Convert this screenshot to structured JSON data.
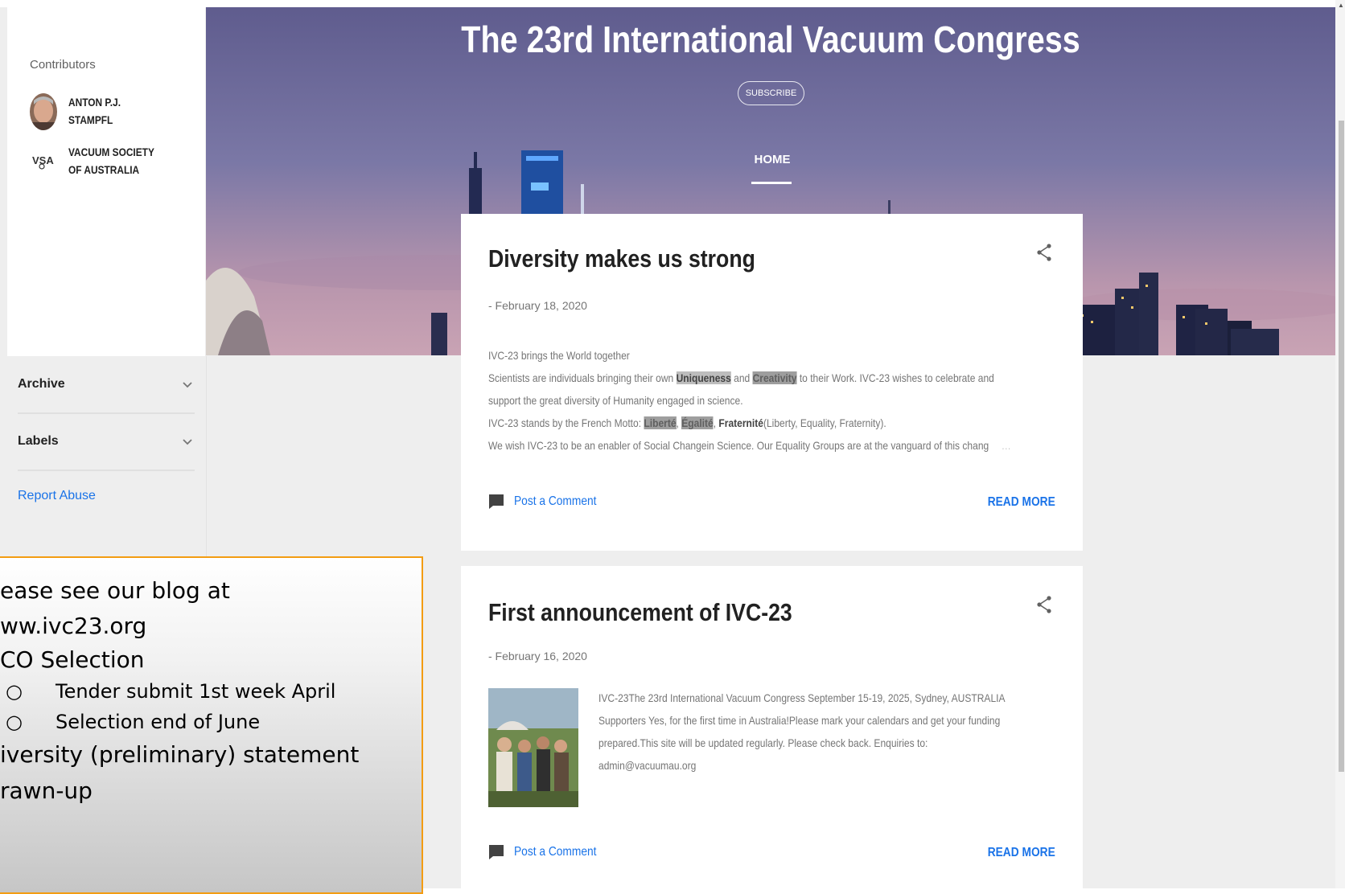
{
  "blog": {
    "title": "The 23rd International Vacuum Congress",
    "subscribe_label": "SUBSCRIBE",
    "nav_home": "HOME"
  },
  "sidebar": {
    "contributors_title": "Contributors",
    "contributors": [
      {
        "name": "ANTON P.J. STAMPFL"
      },
      {
        "name": "VACUUM SOCIETY OF AUSTRALIA",
        "logo_text": "VSA"
      }
    ],
    "archive_label": "Archive",
    "labels_label": "Labels",
    "report_abuse": "Report Abuse"
  },
  "posts": [
    {
      "title": "Diversity makes us strong",
      "date": "- February 18, 2020",
      "line1": "IVC-23 brings the World together",
      "line2_a": "Scientists are individuals bringing their own ",
      "line2_hl1": "Uniqueness",
      "line2_b": " and ",
      "line2_hl2": "Creativity",
      "line2_c": " to their Work. IVC-23 wishes to celebrate and",
      "line3": "support the great diversity of Humanity engaged in science.",
      "line4_a": "IVC-23 stands by the French Motto: ",
      "line4_hl1": "Liberté",
      "line4_b": ", ",
      "line4_hl2": "Égalité",
      "line4_c": ", ",
      "line4_bold": "Fraternité",
      "line4_d": "(Liberty, Equality, Fraternity).",
      "line5": "We wish IVC-23 to be an  enabler of Social Changein Science.  Our Equality Groups are at the vanguard of this chang",
      "ellipsis": "…",
      "comment_label": "Post a Comment",
      "read_more": "READ MORE"
    },
    {
      "title": "First announcement of IVC-23",
      "date": "- February 16, 2020",
      "body_l1": "IVC-23The 23rd International Vacuum Congress September 15-19, 2025, Sydney, AUSTRALIA",
      "body_l2": "Supporters Yes, for the first time in Australia!Please mark your calendars and get your funding",
      "body_l3": "prepared.This site will be updated regularly. Please check back. Enquiries to:",
      "body_l4": "admin@vacuumau.org",
      "comment_label": "Post a Comment",
      "read_more": "READ MORE"
    }
  ],
  "note": {
    "line1": "ease see our blog at",
    "line2": "ww.ivc23.org",
    "line3": "CO Selection",
    "bullets": [
      "Tender submit 1st week April",
      "Selection end of June"
    ],
    "bullet_glyph": "○",
    "line4": "iversity (preliminary) statement",
    "line5": "rawn-up"
  },
  "colors": {
    "accent": "#1a73e8",
    "note_border": "#f39c12",
    "banner_sky_top": "#6d6a9c",
    "banner_sky_bottom": "#c9a3b4"
  }
}
